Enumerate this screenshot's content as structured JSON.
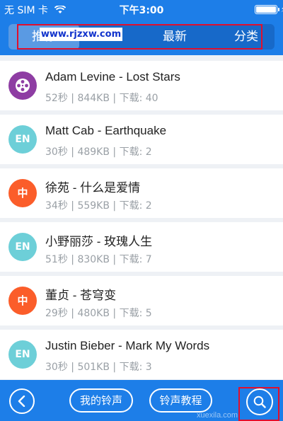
{
  "status_bar": {
    "carrier": "无 SIM 卡",
    "time": "下午3:00",
    "icons": [
      "wifi-icon",
      "battery-icon",
      "charging-icon"
    ]
  },
  "tabs": {
    "overlay_text": "www.rjzxw.com",
    "items": [
      {
        "label": "推荐",
        "active": true
      },
      {
        "label": "最新",
        "active": false
      },
      {
        "label": "分类",
        "active": false
      }
    ]
  },
  "ringtones": [
    {
      "title": "Adam Levine - Lost Stars",
      "duration": "52秒",
      "size": "844KB",
      "downloads": "下载: 40",
      "avatar_text": "",
      "avatar_type": "reel"
    },
    {
      "title": "Matt Cab - Earthquake",
      "duration": "30秒",
      "size": "489KB",
      "downloads": "下载: 2",
      "avatar_text": "EN",
      "avatar_type": "en"
    },
    {
      "title": "徐苑 - 什么是爱情",
      "duration": "34秒",
      "size": "559KB",
      "downloads": "下载: 2",
      "avatar_text": "中",
      "avatar_type": "zh"
    },
    {
      "title": "小野丽莎 - 玫瑰人生",
      "duration": "51秒",
      "size": "830KB",
      "downloads": "下载: 7",
      "avatar_text": "EN",
      "avatar_type": "en"
    },
    {
      "title": "董贞 - 苍穹变",
      "duration": "29秒",
      "size": "480KB",
      "downloads": "下载: 5",
      "avatar_text": "中",
      "avatar_type": "zh"
    },
    {
      "title": "Justin Bieber - Mark My Words",
      "duration": "30秒",
      "size": "501KB",
      "downloads": "下载: 3",
      "avatar_text": "EN",
      "avatar_type": "en"
    }
  ],
  "bottom_bar": {
    "my_ringtones": "我的铃声",
    "tutorial": "铃声教程",
    "watermark": "xuexila.com"
  },
  "colors": {
    "primary": "#1d7ee8",
    "highlight": "#e10f2d",
    "avatar_en": "#6dcfd8",
    "avatar_zh": "#fb5d2a",
    "avatar_reel": "#8e3da3"
  }
}
